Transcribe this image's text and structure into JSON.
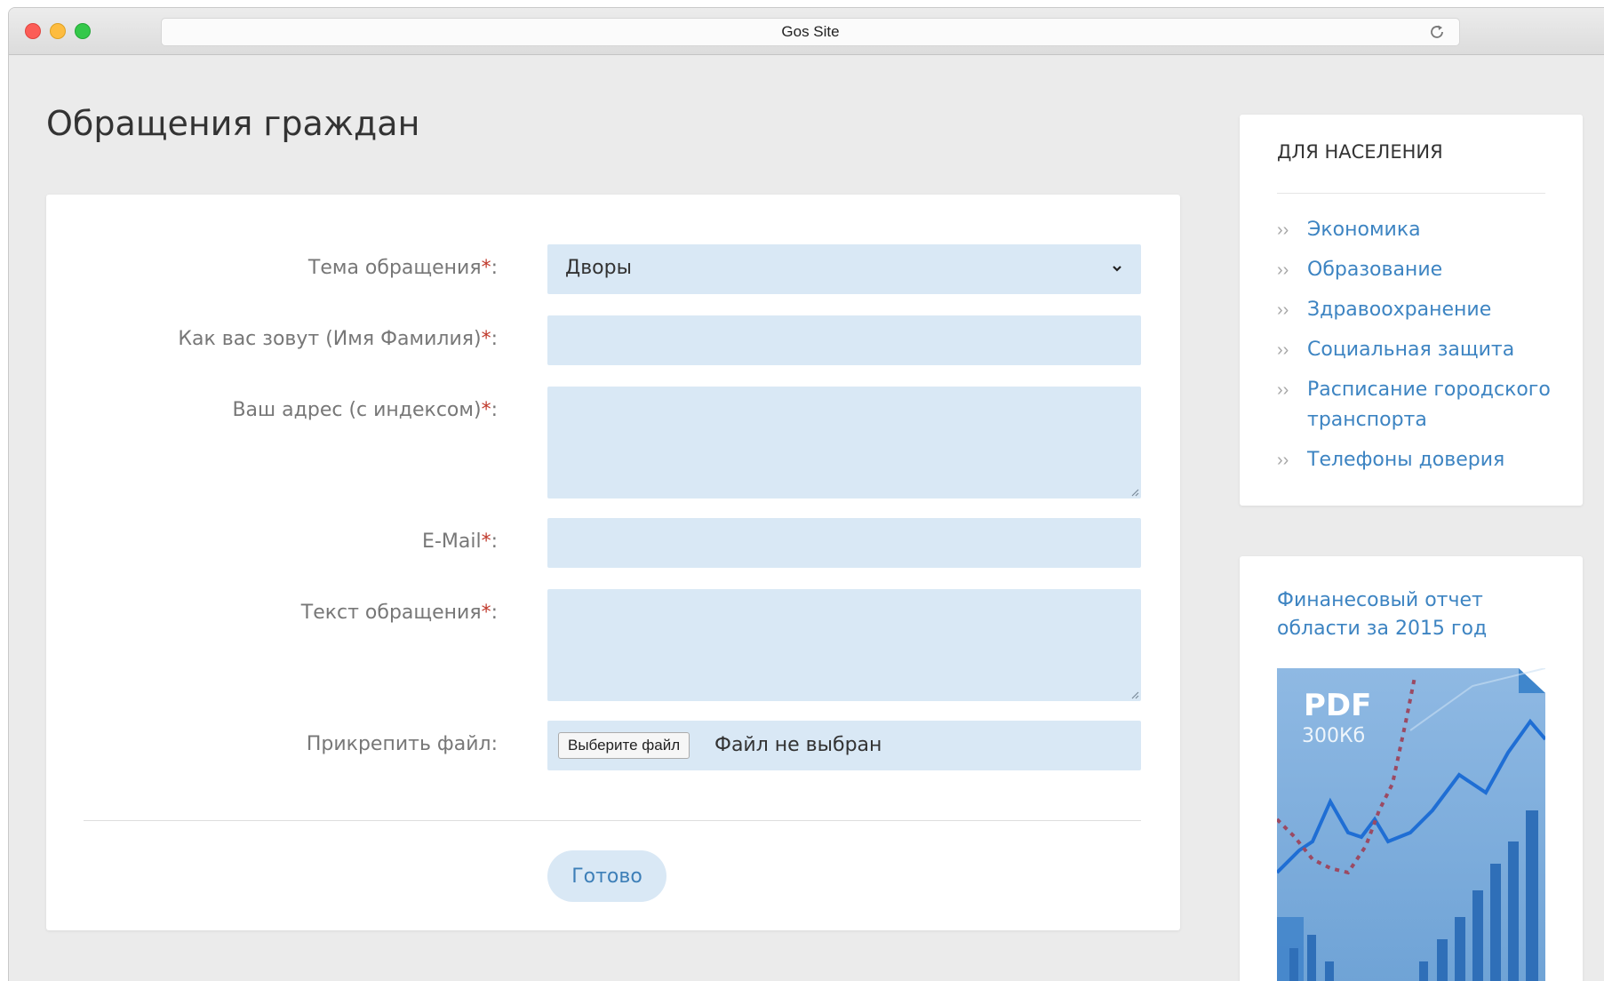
{
  "browser": {
    "url_title": "Gos Site"
  },
  "page": {
    "title": "Обращения граждан"
  },
  "form": {
    "fields": [
      {
        "label": "Тема обращения",
        "required_mark": "*",
        "suffix": ":",
        "value": "Дворы"
      },
      {
        "label": "Как вас зовут (Имя Фамилия)",
        "required_mark": "*",
        "suffix": ":",
        "value": ""
      },
      {
        "label": "Ваш адрес (с индексом)",
        "required_mark": "*",
        "suffix": ":",
        "value": ""
      },
      {
        "label": "E-Mail",
        "required_mark": "*",
        "suffix": ":",
        "value": ""
      },
      {
        "label": "Текст обращения",
        "required_mark": "*",
        "suffix": ":",
        "value": ""
      },
      {
        "label": "Прикрепить файл",
        "required_mark": "",
        "suffix": ":",
        "button_label": "Выберите файл",
        "status": "Файл не выбран"
      }
    ],
    "submit_label": "Готово"
  },
  "sidebar": {
    "nav": {
      "title": "ДЛЯ НАСЕЛЕНИЯ",
      "bullet": "››",
      "items": [
        "Экономика",
        "Образование",
        "Здравоохранение",
        "Социальная защита",
        "Расписание городского транспорта",
        "Телефоны доверия"
      ]
    },
    "report": {
      "link_text": "Финанесовый отчет области за 2015 год",
      "file_type": "PDF",
      "file_size": "300Кб"
    }
  },
  "colors": {
    "field_bg": "#d9e8f5",
    "link": "#3d84c2",
    "required": "#c0392b",
    "page_bg": "#ebebeb"
  }
}
